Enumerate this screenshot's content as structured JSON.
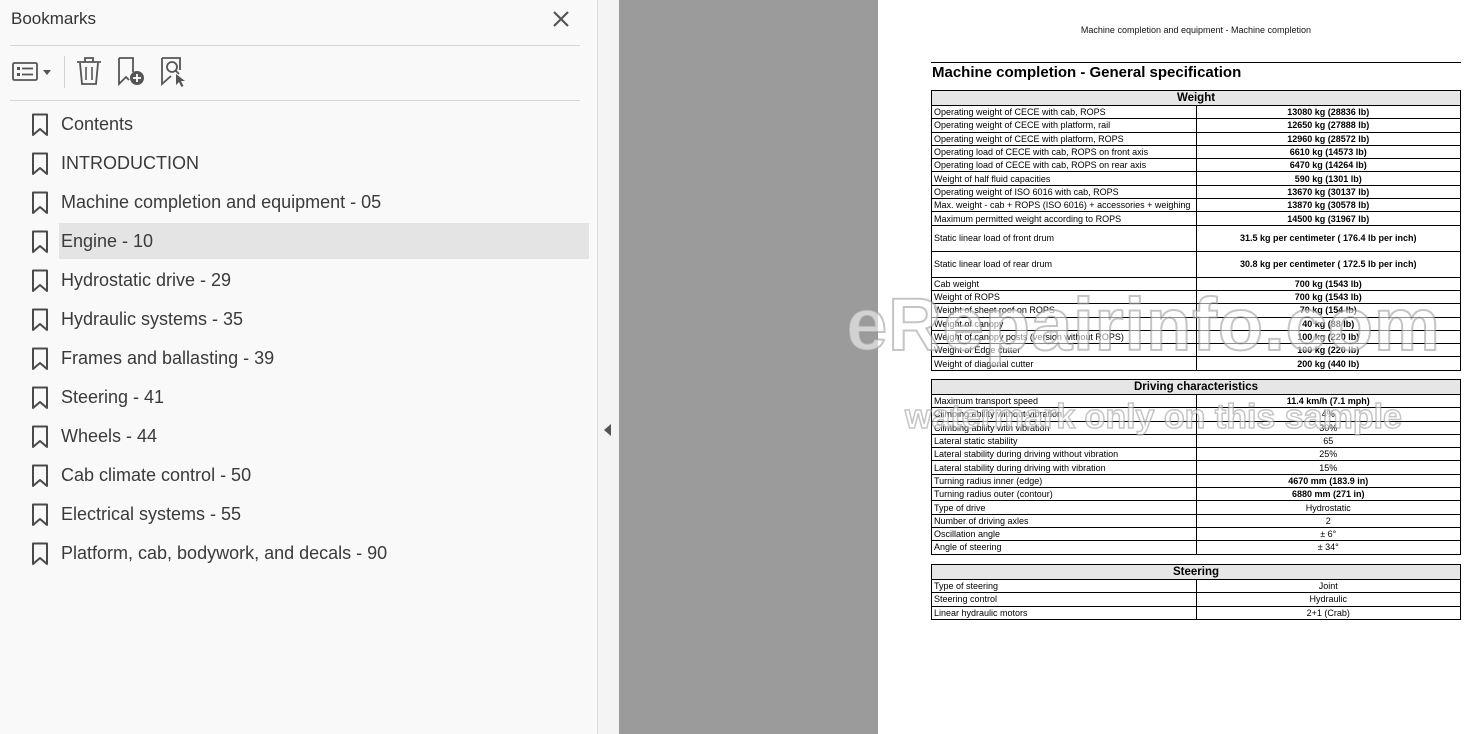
{
  "bookmarks_panel": {
    "title": "Bookmarks",
    "items": [
      {
        "label": "Contents",
        "selected": false
      },
      {
        "label": "INTRODUCTION",
        "selected": false
      },
      {
        "label": "Machine completion and equipment - 05",
        "selected": false
      },
      {
        "label": "Engine - 10",
        "selected": true
      },
      {
        "label": "Hydrostatic drive - 29",
        "selected": false
      },
      {
        "label": "Hydraulic systems - 35",
        "selected": false
      },
      {
        "label": "Frames and ballasting - 39",
        "selected": false
      },
      {
        "label": "Steering - 41",
        "selected": false
      },
      {
        "label": "Wheels - 44",
        "selected": false
      },
      {
        "label": "Cab climate control - 50",
        "selected": false
      },
      {
        "label": "Electrical systems - 55",
        "selected": false
      },
      {
        "label": "Platform, cab, bodywork, and decals - 90",
        "selected": false
      }
    ]
  },
  "document": {
    "header": "Machine completion and equipment - Machine completion",
    "title": "Machine completion - General specification",
    "sections": [
      {
        "heading": "Weight",
        "rows": [
          {
            "label": "Operating weight of CECE with cab, ROPS",
            "value": "13080 kg (28836 lb)",
            "bold": true
          },
          {
            "label": "Operating weight of CECE with platform, rail",
            "value": "12650 kg (27888 lb)",
            "bold": true
          },
          {
            "label": "Operating weight of CECE with platform, ROPS",
            "value": "12960 kg (28572 lb)",
            "bold": true
          },
          {
            "label": "Operating load of CECE with cab, ROPS on front axis",
            "value": "6610 kg (14573 lb)",
            "bold": true
          },
          {
            "label": "Operating load of CECE with cab, ROPS on rear axis",
            "value": "6470 kg (14264 lb)",
            "bold": true
          },
          {
            "label": "Weight of half fluid capacities",
            "value": "590 kg (1301 lb)",
            "bold": true
          },
          {
            "label": "Operating weight of ISO 6016 with cab, ROPS",
            "value": "13670 kg (30137 lb)",
            "bold": true
          },
          {
            "label": "Max. weight - cab + ROPS (ISO 6016) + accessories + weighing",
            "value": "13870 kg (30578 lb)",
            "bold": true
          },
          {
            "label": "Maximum permitted weight according to ROPS",
            "value": "14500 kg (31967 lb)",
            "bold": true
          },
          {
            "label": "Static linear load of front drum",
            "value": "31.5 kg per centimeter ( 176.4 lb per inch)",
            "bold": true,
            "tall": true
          },
          {
            "label": "Static linear load of rear drum",
            "value": "30.8 kg per centimeter ( 172.5 lb per inch)",
            "bold": true,
            "tall": true
          },
          {
            "label": "Cab weight",
            "value": "700 kg (1543 lb)",
            "bold": true
          },
          {
            "label": "Weight of ROPS",
            "value": "700 kg (1543 lb)",
            "bold": true
          },
          {
            "label": "Weight of sheet roof on ROPS",
            "value": "70 kg (154 lb)",
            "bold": true
          },
          {
            "label": "Weight of canopy",
            "value": "40 kg (88 lb)",
            "bold": true
          },
          {
            "label": "Weight of canopy posts (version without ROPS)",
            "value": "100 kg (220 lb)",
            "bold": true
          },
          {
            "label": "Weight of Edge cutter",
            "value": "100 kg (220 lb)",
            "bold": true
          },
          {
            "label": "Weight of diagonal cutter",
            "value": "200 kg (440 lb)",
            "bold": true
          }
        ]
      },
      {
        "heading": "Driving characteristics",
        "rows": [
          {
            "label": "Maximum transport speed",
            "value": "11.4 km/h (7.1 mph)",
            "bold": true
          },
          {
            "label": "Climbing ability without vibration",
            "value": "4%",
            "bold": false
          },
          {
            "label": "Climbing ability with vibration",
            "value": "30%",
            "bold": false
          },
          {
            "label": "Lateral static stability",
            "value": "65",
            "bold": false
          },
          {
            "label": "Lateral stability during driving without vibration",
            "value": "25%",
            "bold": false
          },
          {
            "label": "Lateral stability during driving with vibration",
            "value": "15%",
            "bold": false
          },
          {
            "label": "Turning radius inner (edge)",
            "value": "4670 mm (183.9 in)",
            "bold": true
          },
          {
            "label": "Turning radius outer (contour)",
            "value": "6880 mm (271 in)",
            "bold": true
          },
          {
            "label": "Type of drive",
            "value": "Hydrostatic",
            "bold": false
          },
          {
            "label": "Number of driving axles",
            "value": "2",
            "bold": false
          },
          {
            "label": "Oscillation angle",
            "value": "± 6°",
            "bold": false
          },
          {
            "label": "Angle of steering",
            "value": "± 34°",
            "bold": false
          }
        ]
      },
      {
        "heading": "Steering",
        "rows": [
          {
            "label": "Type of steering",
            "value": "Joint",
            "bold": false
          },
          {
            "label": "Steering control",
            "value": "Hydraulic",
            "bold": false
          },
          {
            "label": "Linear hydraulic motors",
            "value": "2+1 (Crab)",
            "bold": false
          }
        ]
      }
    ]
  },
  "watermark": {
    "line1": "eRepairinfo.com",
    "line2": "watermark only on this sample"
  },
  "icons": {
    "close": "close-icon",
    "options": "list-options-icon",
    "delete": "trash-icon",
    "add": "new-bookmark-icon",
    "find": "find-bookmark-icon",
    "bookmark": "bookmark-icon",
    "collapse": "collapse-arrow-icon"
  },
  "colors": {
    "viewer_gray": "#9b9b9b",
    "selected_row": "#e4e4e4",
    "table_header": "#e6e6e6"
  }
}
